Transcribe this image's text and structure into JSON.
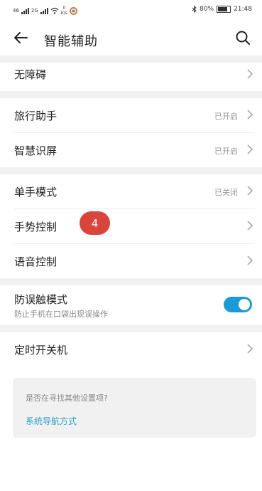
{
  "status_bar": {
    "network_1": "46",
    "network_2": "2G",
    "speed_value": "0",
    "speed_unit": "K/s",
    "battery_percent": "80%",
    "time": "21:48"
  },
  "header": {
    "title": "智能辅助"
  },
  "rows": {
    "accessibility": {
      "label": "无障碍"
    },
    "travel_assistant": {
      "label": "旅行助手",
      "value": "已开启"
    },
    "smart_screen": {
      "label": "智慧识屏",
      "value": "已开启"
    },
    "one_hand_mode": {
      "label": "单手模式",
      "value": "已关闭"
    },
    "gesture_control": {
      "label": "手势控制"
    },
    "voice_control": {
      "label": "语音控制"
    },
    "anti_mistouch": {
      "label": "防误触模式",
      "subtitle": "防止手机在口袋出现误操作",
      "enabled": true
    },
    "scheduled_power": {
      "label": "定时开关机"
    }
  },
  "badge": {
    "text": "4"
  },
  "suggestion": {
    "question": "是否在寻找其他设置项?",
    "link": "系统导航方式"
  },
  "colors": {
    "accent": "#1a9bd7",
    "badge": "#d9443b",
    "link": "#2aa0c8"
  }
}
